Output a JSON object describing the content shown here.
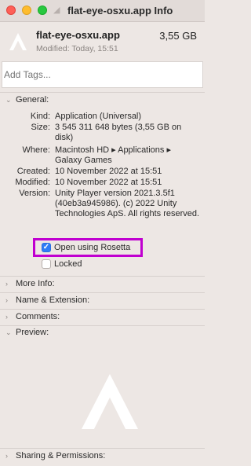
{
  "window": {
    "title": "flat-eye-osxu.app Info"
  },
  "header": {
    "app_name": "flat-eye-osxu.app",
    "size": "3,55 GB",
    "modified": "Modified: Today, 15:51"
  },
  "tags": {
    "placeholder": "Add Tags..."
  },
  "general": {
    "label": "General:",
    "rows": [
      {
        "label": "Kind:",
        "value": "Application (Universal)"
      },
      {
        "label": "Size:",
        "value": "3 545 311 648 bytes (3,55 GB on disk)"
      },
      {
        "label": "Where:",
        "value": "Macintosh HD ▸ Applications ▸ Galaxy Games"
      },
      {
        "label": "Created:",
        "value": "10 November 2022 at 15:51"
      },
      {
        "label": "Modified:",
        "value": "10 November 2022 at 15:51"
      },
      {
        "label": "Version:",
        "value": "Unity Player version 2021.3.5f1 (40eb3a945986). (c) 2022 Unity Technologies ApS. All rights reserved."
      }
    ],
    "open_rosetta_label": "Open using Rosetta",
    "open_rosetta_checked": true,
    "locked_label": "Locked",
    "locked_checked": false
  },
  "sections": {
    "more_info": "More Info:",
    "name_extension": "Name & Extension:",
    "comments": "Comments:",
    "preview": "Preview:",
    "sharing": "Sharing & Permissions:"
  },
  "icons": {
    "app": "unity-icon",
    "expand": "chevron-right-icon",
    "collapse": "chevron-down-icon"
  }
}
